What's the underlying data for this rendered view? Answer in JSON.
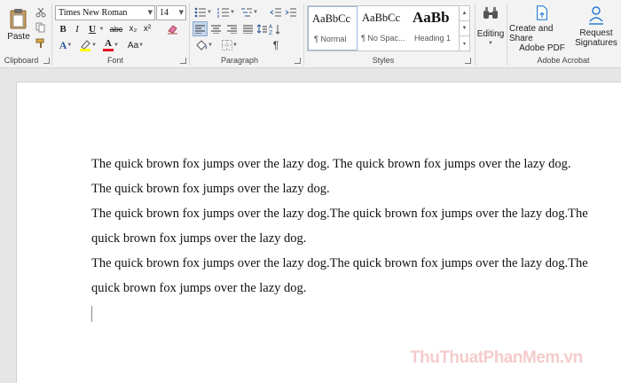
{
  "ribbon": {
    "clipboard": {
      "label": "Clipboard",
      "paste_label": "Paste"
    },
    "font": {
      "label": "Font",
      "font_name": "Times New Roman",
      "font_size": "14",
      "bold": "B",
      "italic": "I",
      "underline": "U",
      "strike": "abc",
      "subscript": "x₂",
      "superscript": "x²",
      "font_color_letter": "A",
      "change_case": "Aa"
    },
    "paragraph": {
      "label": "Paragraph"
    },
    "styles": {
      "label": "Styles",
      "items": [
        {
          "sample": "AaBbCc",
          "name": "¶ Normal"
        },
        {
          "sample": "AaBbCc",
          "name": "¶ No Spac..."
        },
        {
          "sample": "AaBb",
          "name": "Heading 1"
        }
      ]
    },
    "editing": {
      "label": "Editing"
    },
    "adobe": {
      "label": "Adobe Acrobat",
      "create_share_line1": "Create and Share",
      "create_share_line2": "Adobe PDF",
      "request_line1": "Request",
      "request_line2": "Signatures"
    }
  },
  "document": {
    "paragraphs": [
      "The quick brown fox jumps over the lazy dog. The quick brown fox jumps over the lazy dog. The quick brown fox jumps over the lazy dog.",
      "The quick brown fox jumps over the lazy dog.The quick brown fox jumps over the lazy dog.The quick brown fox jumps over the lazy dog.",
      "The quick brown fox jumps over the lazy dog.The quick brown fox jumps over the lazy dog.The quick brown fox jumps over the lazy dog."
    ]
  },
  "watermark": {
    "text": "ThuThuatPhanMem.vn"
  },
  "colors": {
    "accent": "#2b579a",
    "highlight": "#ffff00",
    "font_color": "#e81123",
    "style_selected_border": "#9bb7dd"
  }
}
